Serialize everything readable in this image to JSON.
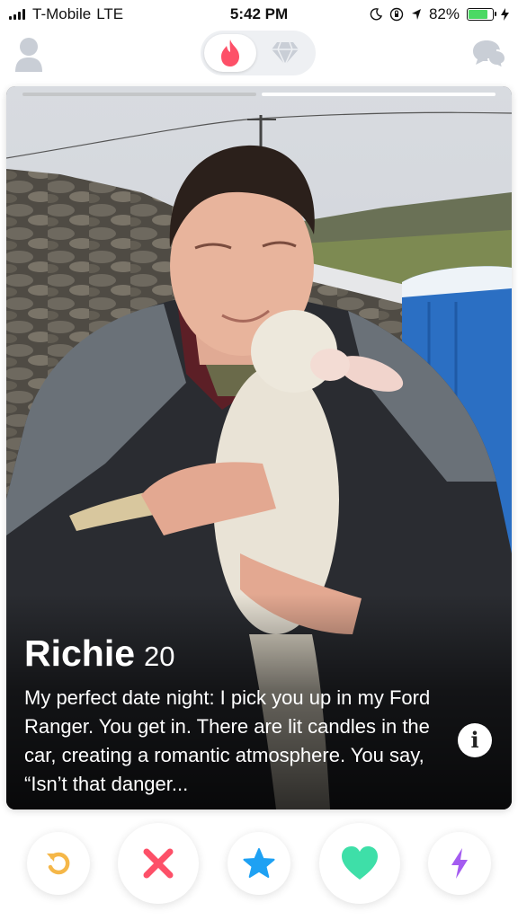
{
  "status_bar": {
    "carrier": "T-Mobile",
    "network": "LTE",
    "time": "5:42 PM",
    "battery_percent": "82%",
    "battery_level": 0.82
  },
  "nav": {
    "profile_icon": "person-icon",
    "active_tab_icon": "flame-icon",
    "inactive_tab_icon": "diamond-icon",
    "messages_icon": "chat-bubbles-icon"
  },
  "card": {
    "photo_count": 2,
    "active_photo_index": 2,
    "name": "Richie",
    "age": "20",
    "bio": "My perfect date night: I pick you up in my Ford Ranger. You get in. There are lit candles in the car, creating a romantic atmosphere. You say, “Isn’t that danger...",
    "info_icon_label": "i"
  },
  "actions": [
    {
      "name": "rewind",
      "icon": "rewind-icon",
      "color": "#f5b748"
    },
    {
      "name": "nope",
      "icon": "close-icon",
      "color": "#fd5068"
    },
    {
      "name": "super-like",
      "icon": "star-icon",
      "color": "#1ea1f3"
    },
    {
      "name": "like",
      "icon": "heart-icon",
      "color": "#3edfa8"
    },
    {
      "name": "boost",
      "icon": "lightning-icon",
      "color": "#a45cf0"
    }
  ],
  "colors": {
    "brand": "#fd5068",
    "inactive_icon": "#c9ced6"
  }
}
